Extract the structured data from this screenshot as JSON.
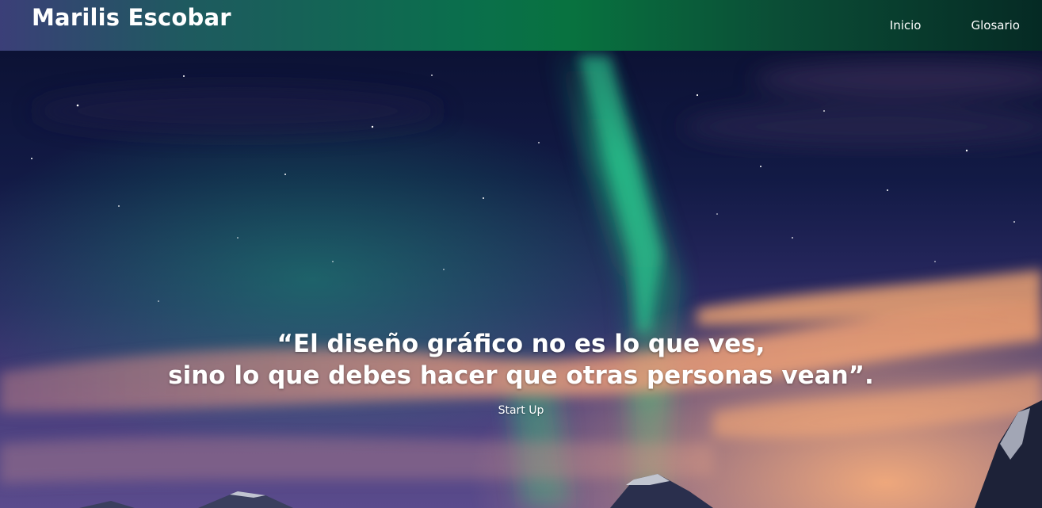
{
  "header": {
    "brand": "Marilis Escobar",
    "nav": [
      {
        "label": "Inicio"
      },
      {
        "label": "Glosario"
      }
    ]
  },
  "hero": {
    "quote_line_1": "“El diseño gráfico no es lo que ves,",
    "quote_line_2": "sino lo que debes hacer que otras personas vean”.",
    "cta_label": "Start Up"
  },
  "colors": {
    "sky": "#0b1030",
    "aurora": "#1fbf7a",
    "clouds": "#f0a070",
    "text": "#ffffff"
  }
}
